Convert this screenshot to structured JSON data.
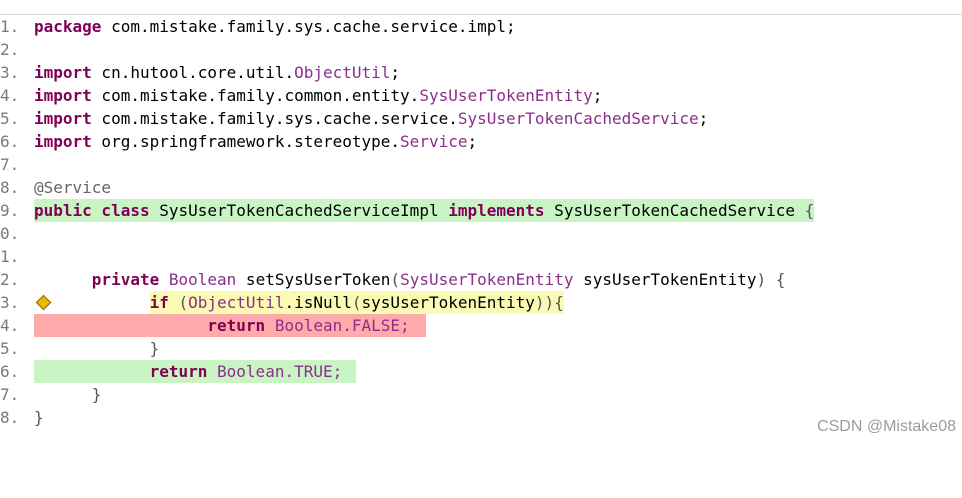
{
  "line_numbers": [
    "1.",
    "2.",
    "3.",
    "4.",
    "5.",
    "6.",
    "7.",
    "8.",
    "9.",
    "0.",
    "1.",
    "2.",
    "3.",
    "4.",
    "5.",
    "6.",
    "7.",
    "8."
  ],
  "code": {
    "l1_kw": "package",
    "l1_rest": " com.mistake.family.sys.cache.service.impl;",
    "l3_kw": "import",
    "l3_pkg": " cn.hutool.core.util.",
    "l3_cls": "ObjectUtil",
    "l3_end": ";",
    "l4_kw": "import",
    "l4_pkg": " com.mistake.family.common.entity.",
    "l4_cls": "SysUserTokenEntity",
    "l4_end": ";",
    "l5_kw": "import",
    "l5_pkg": " com.mistake.family.sys.cache.service.",
    "l5_cls": "SysUserTokenCachedService",
    "l5_end": ";",
    "l6_kw": "import",
    "l6_pkg": " org.springframework.stereotype.",
    "l6_cls": "Service",
    "l6_end": ";",
    "l8_ann": "@Service",
    "l9_kw1": "public class",
    "l9_name": " SysUserTokenCachedServiceImpl ",
    "l9_kw2": "implements",
    "l9_iface": " SysUserTokenCachedService ",
    "l9_brace": "{",
    "l12_kw": "private",
    "l12_type": " Boolean",
    "l12_method": " setSysUserToken",
    "l12_p1": "(",
    "l12_ptype": "SysUserTokenEntity",
    "l12_pname": " sysUserTokenEntity",
    "l12_p2": ") {",
    "l13_kw": "if",
    "l13_p1": " (",
    "l13_cls": "ObjectUtil",
    "l13_call": ".isNull",
    "l13_p2": "(",
    "l13_arg": "sysUserTokenEntity",
    "l13_p3": ")){",
    "l14_kw": "return",
    "l14_val": " Boolean.FALSE;",
    "l15_brace": "}",
    "l16_kw": "return",
    "l16_val": " Boolean.TRUE;",
    "l17_brace": "}",
    "l18_brace": "}"
  },
  "watermark": "CSDN @Mistake08",
  "colors": {
    "covered_green": "#c9f5c4",
    "missed_red": "#ffaaaa",
    "partial_yellow": "#fafab4",
    "keyword": "#7f0055"
  }
}
